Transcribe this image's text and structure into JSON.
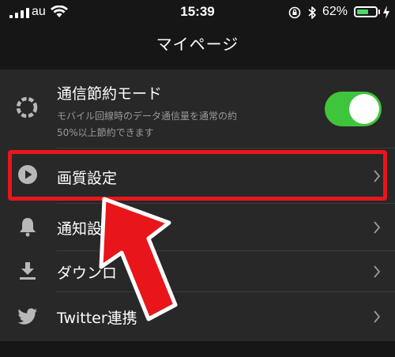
{
  "status_bar": {
    "carrier": "au",
    "time": "15:39",
    "battery_percent": "62%",
    "battery_level": 0.62,
    "icons": [
      "signal-icon",
      "wifi-icon",
      "orientation-lock-icon",
      "bluetooth-icon",
      "battery-icon",
      "charging-icon"
    ]
  },
  "header": {
    "title": "マイページ"
  },
  "settings": {
    "data_saver": {
      "label": "通信節約モード",
      "description_line1": "モバイル回線時のデータ通信量を通常の約",
      "description_line2": "50%以上節約できます",
      "toggle_on": true,
      "icon": "data-saver-icon"
    },
    "video_quality": {
      "label": "画質設定",
      "icon": "play-icon"
    },
    "notifications": {
      "label": "通知設",
      "icon": "bell-icon"
    },
    "downloads": {
      "label": "ダウンロ",
      "icon": "download-icon"
    },
    "twitter": {
      "label": "Twitter連携",
      "icon": "twitter-icon"
    }
  },
  "colors": {
    "background": "#161616",
    "row_background": "#282828",
    "toggle_on": "#3fc53b",
    "annotation_red": "#e8161a",
    "secondary_text": "#9a9a9a",
    "icon_grey": "#b8b8b8"
  }
}
